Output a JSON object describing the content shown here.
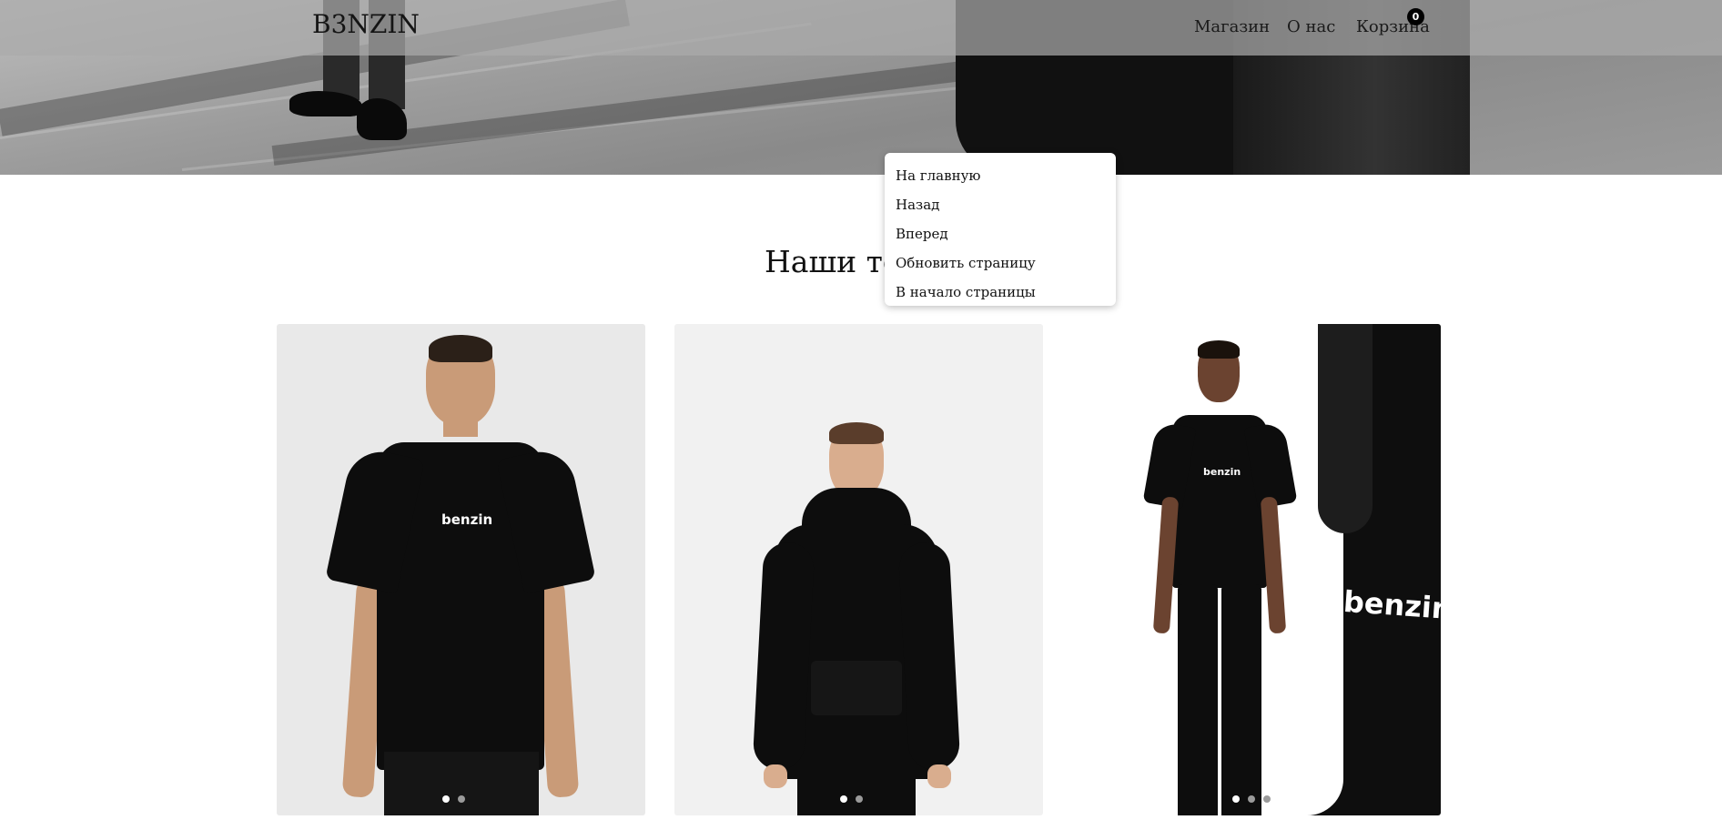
{
  "header": {
    "logo": "B3NZIN",
    "nav": {
      "shop": "Магазин",
      "about": "О нас",
      "cart": "Корзина"
    },
    "cart_count": "0"
  },
  "section": {
    "title": "Наши то"
  },
  "context_menu": {
    "items": [
      "На главную",
      "Назад",
      "Вперед",
      "Обновить страницу",
      "В начало страницы"
    ]
  },
  "products": [
    {
      "print": "benzin",
      "image": "black-tshirt-model",
      "slides": 2,
      "active_slide": 1
    },
    {
      "print": "",
      "image": "black-hoodie-model",
      "slides": 2,
      "active_slide": 1
    },
    {
      "print": "benzin",
      "image": "black-tshirt-and-pants-model",
      "slides": 3,
      "active_slide": 1
    }
  ],
  "colors": {
    "header_bg": "#aaaaaa",
    "badge": "#000000",
    "accent": "#111111"
  }
}
